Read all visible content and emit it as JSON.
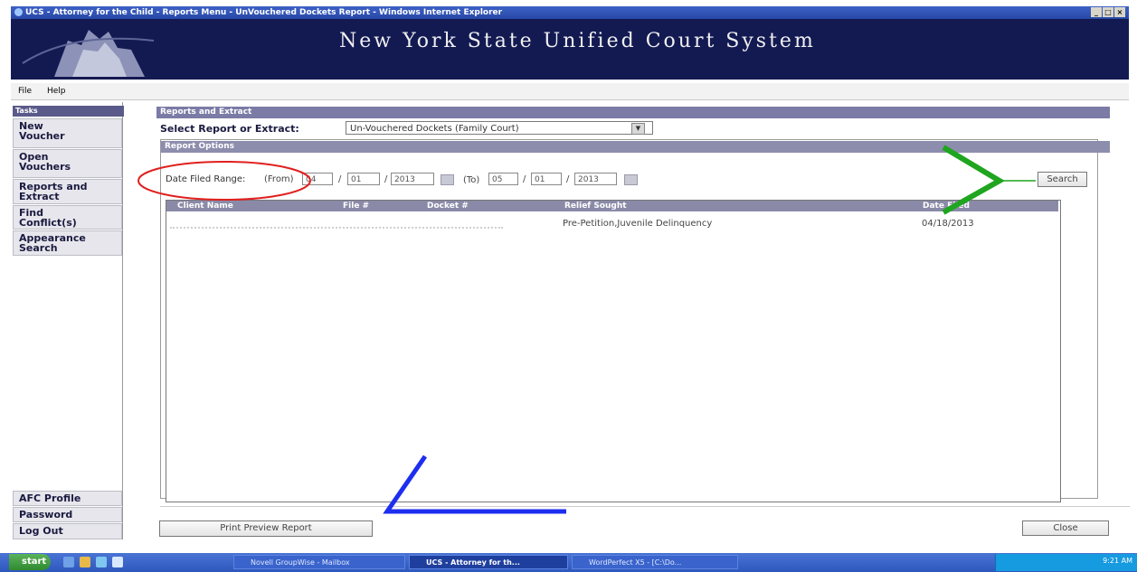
{
  "window": {
    "title": "UCS - Attorney for the Child - Reports Menu - UnVouchered Dockets Report - Windows Internet Explorer",
    "controls": [
      "_",
      "□",
      "×"
    ]
  },
  "banner": {
    "title": "New York State Unified Court System"
  },
  "menu": {
    "items": [
      "File",
      "Help"
    ]
  },
  "sidebar": {
    "header": "Tasks",
    "items": [
      {
        "label": [
          "New",
          "Voucher"
        ]
      },
      {
        "label": [
          "Open",
          "Vouchers"
        ]
      },
      {
        "label": [
          "Reports and",
          "Extract"
        ]
      },
      {
        "label": [
          "Find",
          "Conflict(s)"
        ]
      },
      {
        "label": [
          "Appearance",
          "Search"
        ]
      }
    ],
    "bottom_items": [
      "AFC Profile",
      "Password",
      "Log Out"
    ]
  },
  "reports": {
    "header": "Reports and Extract",
    "select_label": "Select Report or Extract:",
    "select_value": "Un-Vouchered Dockets (Family Court)"
  },
  "options": {
    "header": "Report Options",
    "date_label": "Date Filed Range:",
    "from_label": "(From)",
    "to_label": "(To)",
    "from": {
      "month": "04",
      "day": "01",
      "year": "2013"
    },
    "to": {
      "month": "05",
      "day": "01",
      "year": "2013"
    },
    "sep": "/",
    "search_label": "Search"
  },
  "results": {
    "columns": [
      "Client Name",
      "File #",
      "Docket #",
      "Relief Sought",
      "Date Filed"
    ],
    "rows": [
      {
        "relief": "Pre-Petition,Juvenile Delinquency",
        "date_filed": "04/18/2013"
      }
    ]
  },
  "footer": {
    "print_label": "Print Preview Report",
    "close_label": "Close"
  },
  "taskbar": {
    "start": "start",
    "items": [
      "Novell GroupWise - Mailbox",
      "UCS - Attorney for th...",
      "WordPerfect X5 - [C:\\Do..."
    ],
    "clock": "9:21 AM"
  },
  "colors": {
    "banner": "#131a52",
    "section_header": "#7b7ba6",
    "annotation_red": "#e0201f",
    "annotation_green": "#1fa51f",
    "annotation_blue": "#1d2ef0"
  }
}
